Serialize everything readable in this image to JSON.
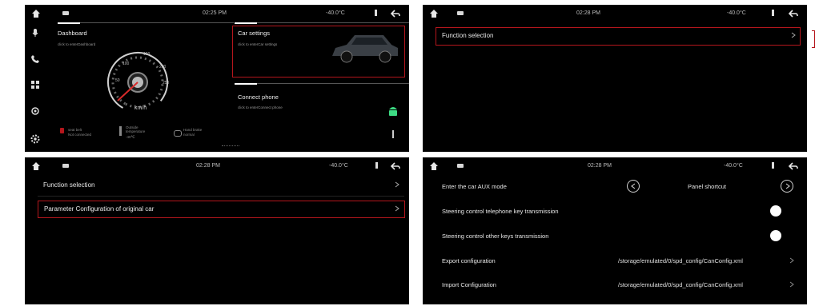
{
  "status": {
    "p1": {
      "time": "02:25 PM",
      "temp": "-40.0°C"
    },
    "p2": {
      "time": "02:28 PM",
      "temp": "-40.0°C"
    },
    "p3": {
      "time": "02:28 PM",
      "temp": "-40.0°C"
    },
    "p4": {
      "time": "02:28 PM",
      "temp": "-40.0°C"
    }
  },
  "home": {
    "dashboard": {
      "title": "Dashboard",
      "subtitle": "click to enterDashboard",
      "unit": "km/h"
    },
    "car_settings": {
      "title": "Car settings",
      "subtitle": "click to enterCar settings"
    },
    "connect_phone": {
      "title": "Connect phone",
      "subtitle": "click to enterConnect phone"
    },
    "indicators": [
      {
        "label": "seat belt",
        "value": "Not connected"
      },
      {
        "label": "Outside temperature",
        "value": "-40℃"
      },
      {
        "label": "Hand brake",
        "value": "normal"
      }
    ],
    "speed_ticks": [
      "0",
      "50",
      "100",
      "150",
      "200",
      "250"
    ]
  },
  "function_menu": {
    "item1": "Function selection"
  },
  "function_menu2": {
    "item1": "Function selection",
    "item2": "Parameter Configuration of original car"
  },
  "config": {
    "aux_label": "Enter the car AUX mode",
    "aux_value": "Panel shortcut",
    "tel_label": "Steering control telephone key transmission",
    "other_label": "Steering control other keys transmission",
    "export_label": "Export configuration",
    "export_path": "/storage/emulated/0/spd_config/CanConfig.xml",
    "import_label": "Import Configuration",
    "import_path": "/storage/emulated/0/spd_config/CanConfig.xml"
  },
  "colors": {
    "accent": "#b5161c",
    "bg": "#000000"
  }
}
